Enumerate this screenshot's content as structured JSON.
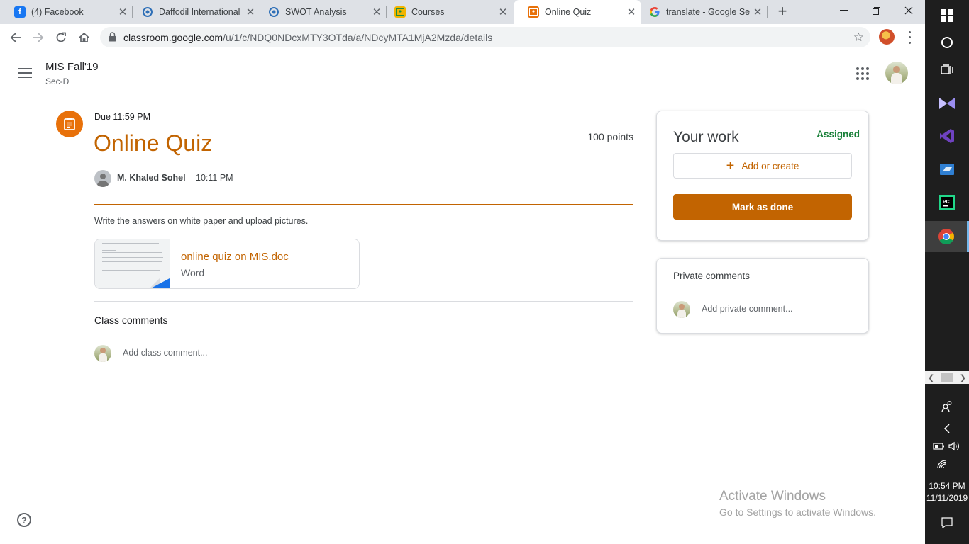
{
  "browser": {
    "tabs": [
      {
        "title": "(4) Facebook",
        "icon": "facebook-icon",
        "color": "#1877f2",
        "active": false
      },
      {
        "title": "Daffodil International",
        "icon": "daffodil-moodle-icon",
        "color": "#2e6fb7",
        "active": false
      },
      {
        "title": "SWOT Analysis",
        "icon": "daffodil-moodle-icon",
        "color": "#2e6fb7",
        "active": false
      },
      {
        "title": "Courses",
        "icon": "google-classroom-icon",
        "color": "#f2b400",
        "active": false
      },
      {
        "title": "Online Quiz",
        "icon": "google-classroom-icon",
        "color": "#e8710a",
        "active": true
      },
      {
        "title": "translate - Google Se",
        "icon": "google-icon",
        "color": "#4285f4",
        "active": false
      }
    ],
    "url_host": "classroom.google.com",
    "url_path": "/u/1/c/NDQ0NDcxMTY3OTda/a/NDcyMTA1MjA2Mzda/details"
  },
  "classroom": {
    "class_name": "MIS Fall'19",
    "section": "Sec-D",
    "assignment": {
      "due": "Due 11:59 PM",
      "title": "Online Quiz",
      "points": "100 points",
      "author": "M. Khaled Sohel",
      "posted_time": "10:11 PM",
      "instructions": "Write the answers on white paper and upload pictures.",
      "attachment": {
        "name": "online quiz on MIS.doc",
        "type": "Word"
      }
    },
    "class_comments_label": "Class comments",
    "class_comment_placeholder": "Add class comment...",
    "your_work": {
      "title": "Your work",
      "status": "Assigned",
      "add_label": "Add or create",
      "mark_done_label": "Mark as done"
    },
    "private_comments": {
      "title": "Private comments",
      "placeholder": "Add private comment..."
    },
    "accent_color": "#c26401"
  },
  "watermark": {
    "line1": "Activate Windows",
    "line2": "Go to Settings to activate Windows."
  },
  "taskbar": {
    "time": "10:54 PM",
    "date": "11/11/2019",
    "apps": [
      "windows-start-icon",
      "cortana-icon",
      "task-view-icon",
      "visual-studio-icon",
      "visual-studio-2019-icon",
      "terminal-icon",
      "pycharm-icon",
      "chrome-icon"
    ]
  }
}
